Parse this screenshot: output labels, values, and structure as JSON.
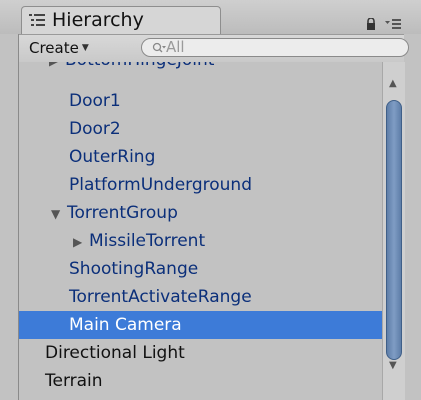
{
  "tab": {
    "title": "Hierarchy",
    "icon": "hierarchy-list-icon"
  },
  "tab_actions": {
    "lock_icon": "lock-icon",
    "menu_icon": "panel-menu-icon"
  },
  "toolbar": {
    "create_label": "Create",
    "search_placeholder": "All"
  },
  "tree": {
    "items": [
      {
        "label": "BottomHingeJoint",
        "partial": true
      },
      {
        "label": "Door1"
      },
      {
        "label": "Door2"
      },
      {
        "label": "OuterRing"
      },
      {
        "label": "PlatformUnderground"
      },
      {
        "label": "TorrentGroup",
        "expanded": true
      },
      {
        "label": "MissileTorrent",
        "collapsed": true
      },
      {
        "label": "ShootingRange"
      },
      {
        "label": "TorrentActivateRange"
      },
      {
        "label": "Main Camera",
        "selected": true
      },
      {
        "label": "Directional Light"
      },
      {
        "label": "Terrain"
      }
    ]
  },
  "colors": {
    "selection": "#3d7bd8",
    "prefab_text": "#0b2f7a",
    "panel": "#c2c2c2"
  }
}
